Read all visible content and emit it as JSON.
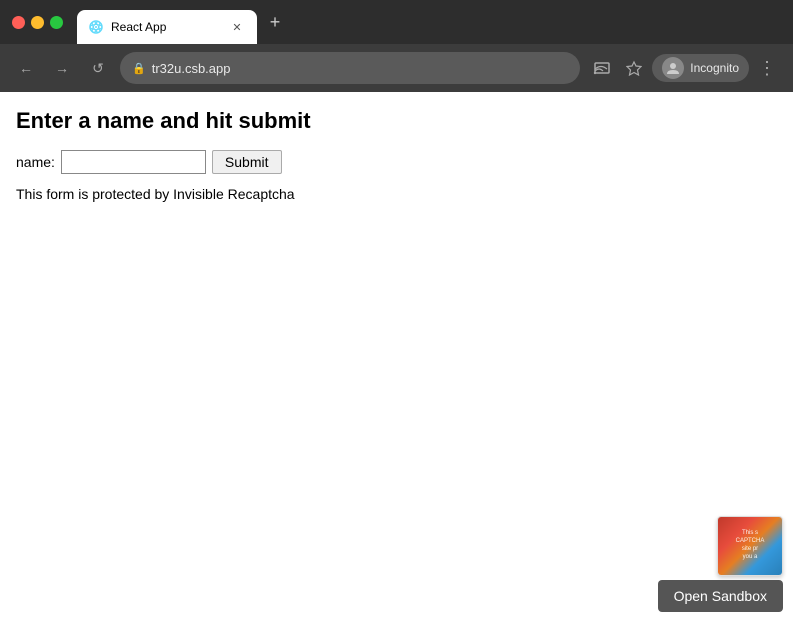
{
  "browser": {
    "tab": {
      "title": "React App",
      "favicon": "react-icon"
    },
    "url": "tr32u.csb.app",
    "incognito_label": "Incognito",
    "new_tab_label": "+"
  },
  "nav": {
    "back_label": "←",
    "forward_label": "→",
    "reload_label": "↺"
  },
  "toolbar": {
    "cast_icon": "cast-icon",
    "bookmark_icon": "star-icon",
    "more_icon": "⋮"
  },
  "page": {
    "heading": "Enter a name and hit submit",
    "form": {
      "label": "name:",
      "input_placeholder": "",
      "submit_label": "Submit"
    },
    "recaptcha_text": "This form is protected by Invisible Recaptcha"
  },
  "captcha_widget": {
    "lines": [
      "This s",
      "CAPTCHA",
      "site pr",
      "you a"
    ]
  },
  "sandbox_button": {
    "label": "Open Sandbox"
  }
}
